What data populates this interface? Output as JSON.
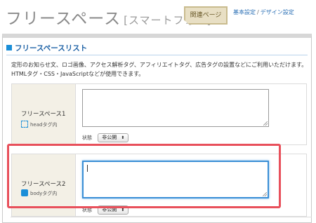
{
  "header": {
    "title": "フリースペース",
    "title_sub": "[スマートフォン]",
    "related_label": "関連ページ",
    "links": [
      "基本設定",
      "/",
      "デザイン設定"
    ]
  },
  "section": {
    "title": "フリースペースリスト",
    "desc_line1": "定形のお知らせ文、ロゴ画像、アクセス解析タグ、アフィリエイトタグ、広告タグの設置などにご利用いただけます。",
    "desc_line2": "HTMLタグ・CSS・JavaScriptなどが使用できます。"
  },
  "rows": [
    {
      "name": "フリースペース1",
      "tag": "headタグ内",
      "status_label": "状態",
      "status_value": "非公開",
      "icon": "head-tag-icon"
    },
    {
      "name": "フリースペース2",
      "tag": "bodyタグ内",
      "status_label": "状態",
      "status_value": "非公開",
      "icon": "body-tag-icon"
    }
  ],
  "colors": {
    "accent": "#1a8ed8",
    "highlight": "#e8505b",
    "link": "#2a6fb5"
  }
}
